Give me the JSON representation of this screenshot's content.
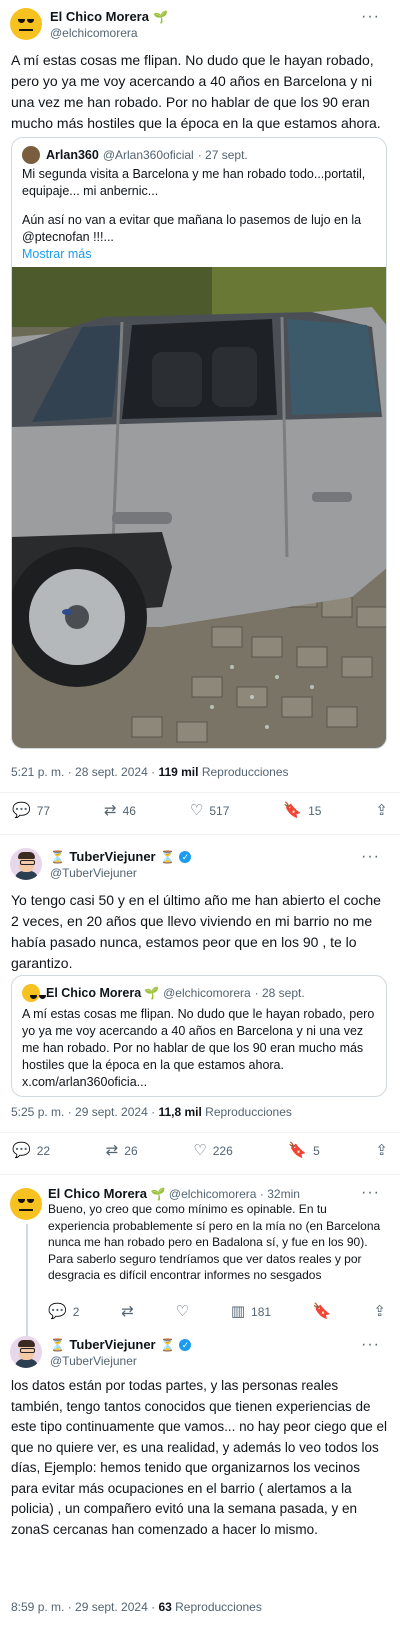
{
  "tweet1": {
    "name": "El Chico Morera",
    "handle": "@elchicomorera",
    "text": "A mí estas cosas me flipan. No dudo que le hayan robado, pero yo ya me voy acercando a 40 años en Barcelona y ni una vez me han robado. Por no hablar de que los 90 eran mucho más hostiles que la época en la que estamos ahora.",
    "quote": {
      "name": "Arlan360",
      "handle": "@Arlan360oficial",
      "date": "· 27 sept.",
      "line1": "Mi segunda visita a Barcelona y me han robado todo...portatil, equipaje... mi anbernic...",
      "line2": "Aún así no van a evitar que mañana lo pasemos de lujo en la @ptecnofan !!!...",
      "show_more": "Mostrar más"
    },
    "time": "5:21 p. m. · 28 sept. 2024 ·",
    "views_count": "119 mil",
    "views_label": "Reproducciones",
    "replies": "77",
    "retweets": "46",
    "likes": "517",
    "bookmarks": "15"
  },
  "tweet2": {
    "name": "TuberViejuner",
    "handle": "@TuberViejuner",
    "text": "Yo tengo casi 50 y en el último año me han abierto el coche 2 veces, en 20 años que llevo viviendo en mi barrio no me había pasado nunca, estamos peor que en los 90 , te lo garantizo.",
    "quote": {
      "name": "El Chico Morera",
      "handle": "@elchicomorera",
      "date": "· 28 sept.",
      "text": "A mí estas cosas me flipan. No dudo que le hayan robado, pero yo ya me voy acercando a 40 años en Barcelona y ni una vez me han robado. Por no hablar de que los 90 eran mucho más hostiles que la época en la que estamos ahora.",
      "link": "x.com/arlan360oficia..."
    },
    "time": "5:25 p. m. · 29 sept. 2024 ·",
    "views_count": "11,8 mil",
    "views_label": "Reproducciones",
    "replies": "22",
    "retweets": "26",
    "likes": "226",
    "bookmarks": "5"
  },
  "reply1": {
    "name": "El Chico Morera",
    "handle": "@elchicomorera",
    "age": "· 32min",
    "text": "Bueno, yo creo que como mínimo es opinable. En tu experiencia probablemente sí pero en la mía no (en Barcelona nunca me han robado pero en Badalona sí, y fue en los 90). Para saberlo seguro tendríamos que ver datos reales  y por desgracia es difícil encontrar informes no sesgados",
    "replies": "2",
    "views": "181"
  },
  "reply2": {
    "name": "TuberViejuner",
    "handle": "@TuberViejuner",
    "text": "los datos están por todas partes, y las personas reales también, tengo tantos conocidos que tienen experiencias de este tipo continuamente que vamos... no hay peor ciego que el que no quiere ver, es una realidad, y además lo veo todos los días, Ejemplo:  hemos tenido que organizarnos los vecinos para evitar más ocupaciones en el barrio ( alertamos a la policia) , un compañero evitó una la semana pasada, y en zonaS cercanas han comenzado a hacer lo mismo.",
    "time": "8:59 p. m. · 29 sept. 2024 ·",
    "views_count": "63",
    "views_label": "Reproducciones"
  },
  "icons": {
    "more": "more-icon",
    "verified": "verified-badge-icon",
    "reply": "reply-icon",
    "retweet": "retweet-icon",
    "like": "like-icon",
    "bookmark": "bookmark-icon",
    "share": "share-icon",
    "views": "views-icon"
  },
  "colors": {
    "accent": "#1d9bf0",
    "muted": "#536471",
    "text": "#0f1419"
  }
}
